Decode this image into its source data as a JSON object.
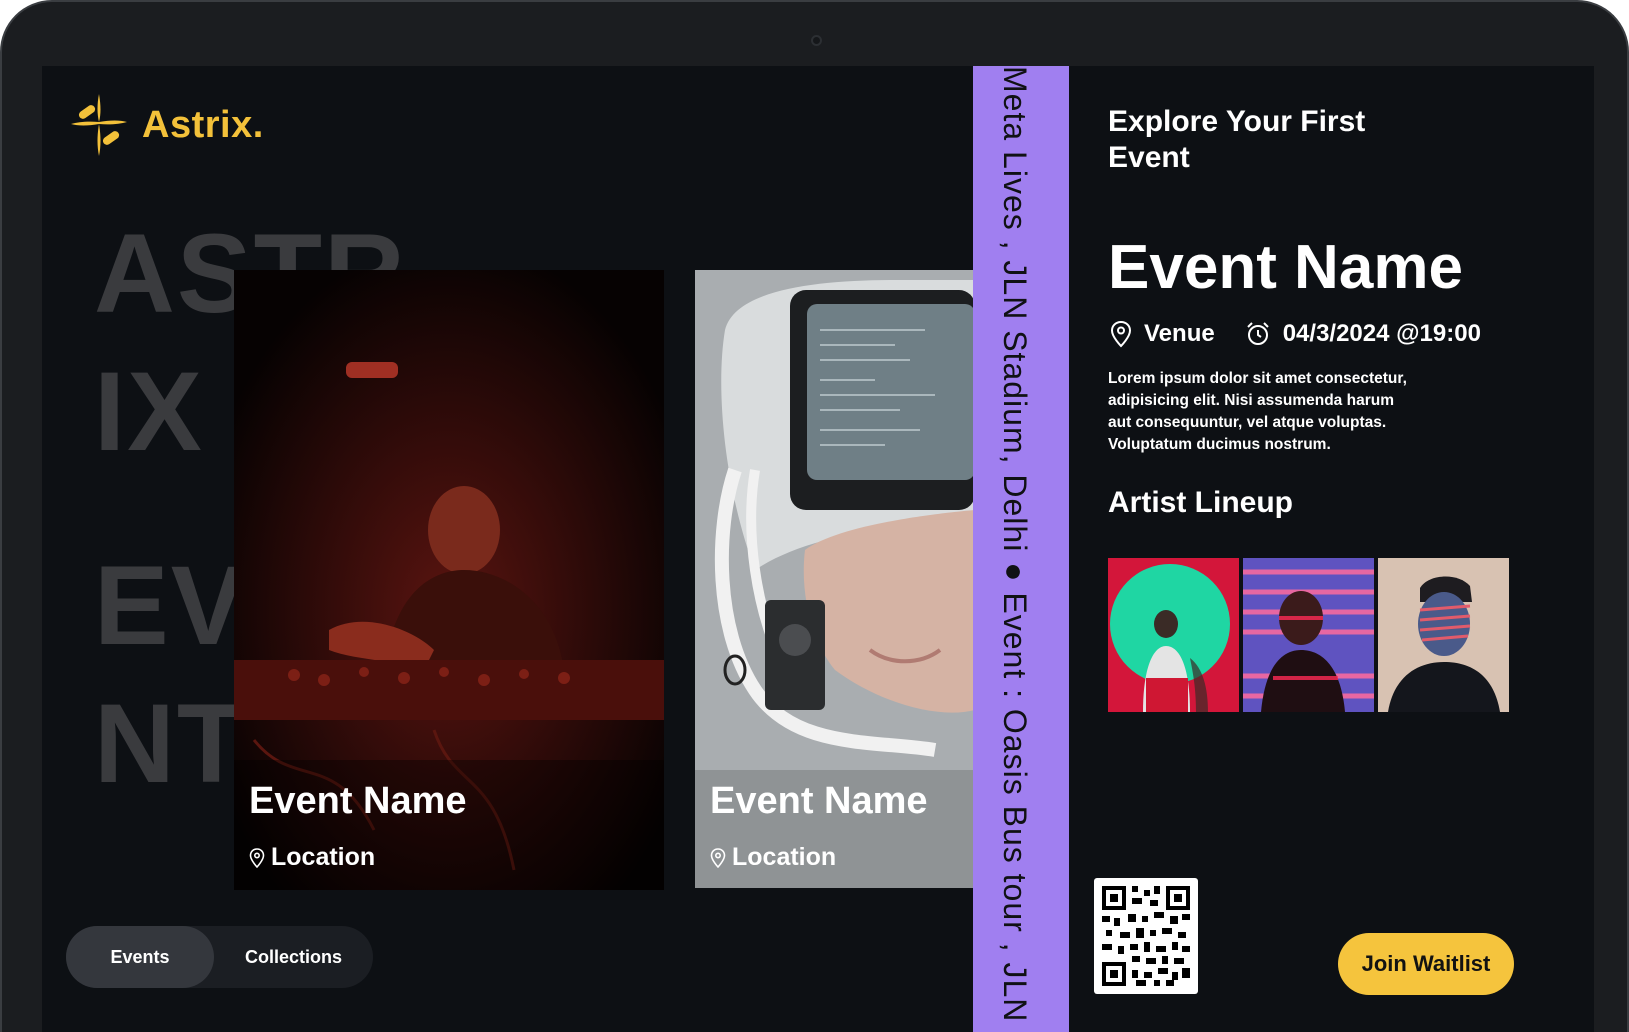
{
  "brand": {
    "name": "Astrix.",
    "logo_icon": "astrix-star-logo-icon",
    "color": "#f3c13a"
  },
  "background_words": [
    "ASTR",
    "IX",
    "EV",
    "NT"
  ],
  "cards": [
    {
      "title": "Event Name",
      "location": "Location",
      "image": "dj-mixing-red-light-photo"
    },
    {
      "title": "Event Name",
      "location": "Location",
      "image": "person-with-retro-tv-helmet-photo"
    }
  ],
  "tabs": [
    {
      "label": "Events",
      "active": true
    },
    {
      "label": "Collections",
      "active": false
    }
  ],
  "ticker": {
    "text": "Meta Lives , JLN Stadium, Delhi  ●  Event : Oasis Bus tour , JLN",
    "color": "#a07ff0"
  },
  "detail": {
    "heading": "Explore Your First Event",
    "event_name": "Event Name",
    "venue": "Venue",
    "datetime": "04/3/2024 @19:00",
    "description": "Lorem ipsum dolor sit amet consectetur, adipisicing elit. Nisi assumenda harum aut consequuntur, vel atque voluptas. Voluptatum ducimus nostrum.",
    "lineup_title": "Artist Lineup",
    "artists": [
      "artist-green-circle-photo",
      "artist-stay-home-neon-photo",
      "artist-light-stripes-photo"
    ]
  },
  "qr_icon": "qr-code-icon",
  "cta": {
    "label": "Join Waitlist",
    "color": "#f5c43d"
  }
}
